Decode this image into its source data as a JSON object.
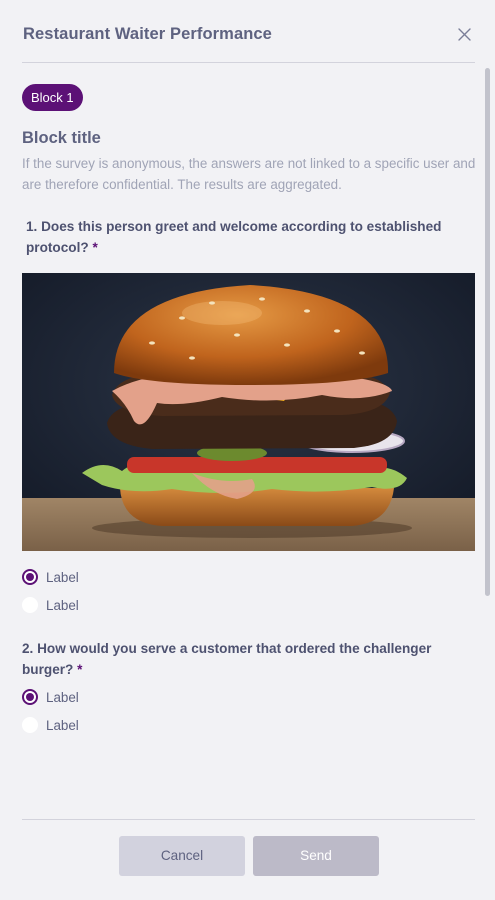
{
  "header": {
    "title": "Restaurant Waiter Performance"
  },
  "block": {
    "badge": "Block 1",
    "title": "Block title",
    "description": "If the survey is anonymous, the answers are not linked to a specific user and are therefore confidential. The results are aggregated."
  },
  "questions": [
    {
      "text": "1. Does this person greet and welcome according to established protocol?",
      "required_mark": "*",
      "image": "burger-photo",
      "options": [
        {
          "label": "Label",
          "selected": true
        },
        {
          "label": "Label",
          "selected": false
        }
      ]
    },
    {
      "text": "2. How would you serve a customer that ordered the challenger burger?",
      "required_mark": "*",
      "options": [
        {
          "label": "Label",
          "selected": true
        },
        {
          "label": "Label",
          "selected": false
        }
      ]
    }
  ],
  "footer": {
    "cancel_label": "Cancel",
    "send_label": "Send"
  },
  "colors": {
    "accent": "#5c1176",
    "background": "#f2f2f5",
    "cancel_bg": "#d2d2de",
    "send_bg": "#bcbac8"
  },
  "icons": {
    "close": "close-icon"
  }
}
